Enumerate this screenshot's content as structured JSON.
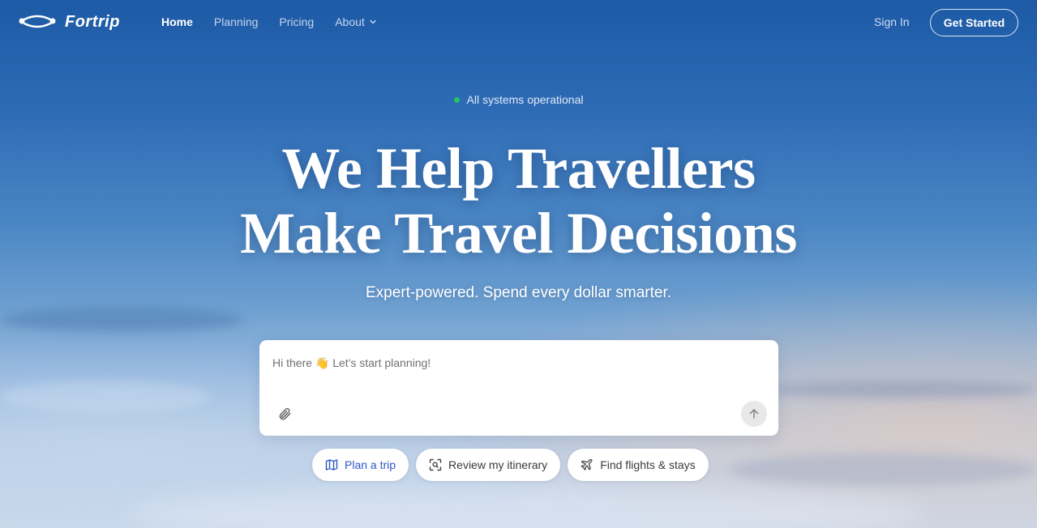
{
  "brand": {
    "name": "Fortrip"
  },
  "nav": {
    "links": [
      {
        "label": "Home",
        "active": true
      },
      {
        "label": "Planning",
        "active": false
      },
      {
        "label": "Pricing",
        "active": false
      },
      {
        "label": "About",
        "active": false,
        "has_dropdown": true
      }
    ],
    "sign_in": "Sign In",
    "get_started": "Get Started"
  },
  "status": {
    "text": "All systems operational",
    "color": "#22c55e"
  },
  "hero": {
    "headline_line1": "We Help Travellers",
    "headline_line2": "Make Travel Decisions",
    "subhead": "Expert-powered. Spend every dollar smarter."
  },
  "chat": {
    "placeholder": "Hi there 👋 Let's start planning!",
    "value": ""
  },
  "chips": [
    {
      "label": "Plan a trip",
      "icon": "map-icon"
    },
    {
      "label": "Review my itinerary",
      "icon": "scan-icon"
    },
    {
      "label": "Find flights & stays",
      "icon": "plane-icon"
    }
  ],
  "colors": {
    "accent": "#2f55c9",
    "sky_top": "#1d5aa6",
    "sky_bottom": "#c9d7ea"
  }
}
